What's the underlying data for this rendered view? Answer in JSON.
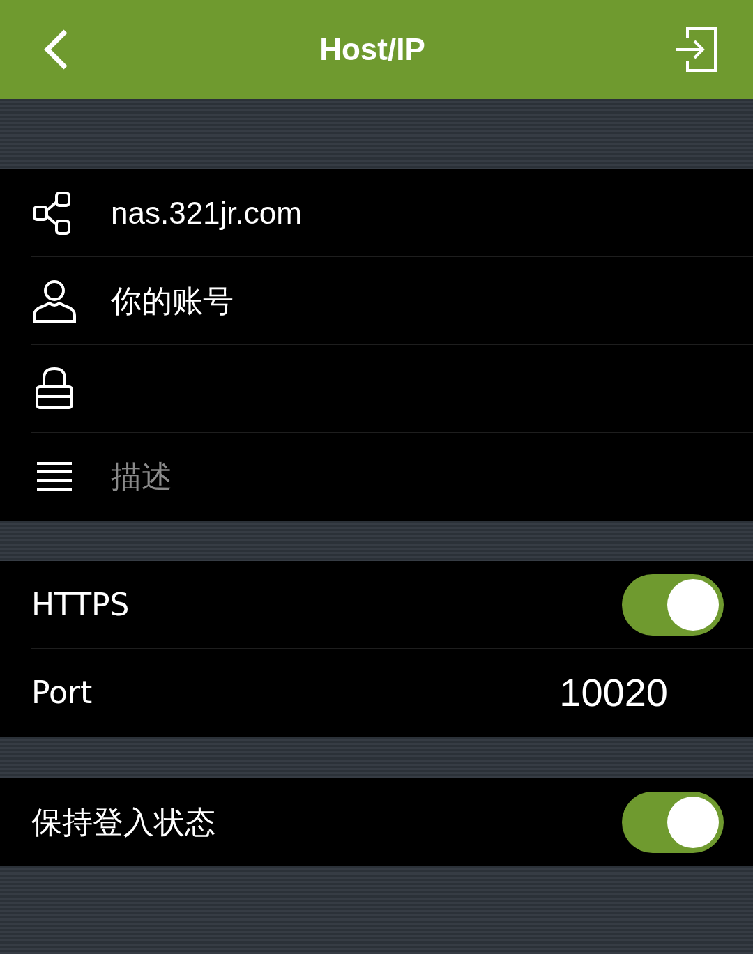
{
  "header": {
    "title": "Host/IP"
  },
  "fields": [
    {
      "kind": "host",
      "value": "nas.321jr.com"
    },
    {
      "kind": "account",
      "value": "你的账号"
    },
    {
      "kind": "password"
    },
    {
      "kind": "description",
      "placeholder": "描述"
    }
  ],
  "connection": [
    {
      "kind": "toggle",
      "label": "HTTPS",
      "on": true
    },
    {
      "kind": "value",
      "label": "Port",
      "value": "10020"
    }
  ],
  "options": [
    {
      "kind": "toggle",
      "label": "保持登入状态",
      "on": true
    }
  ]
}
